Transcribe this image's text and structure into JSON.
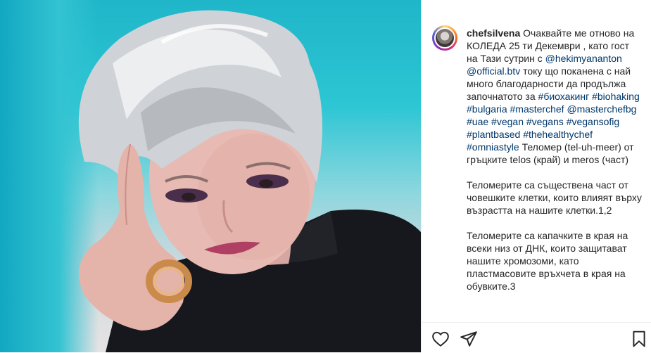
{
  "post": {
    "media_alt": "",
    "author": {
      "username": "chefsilvena",
      "avatar_icon": "avatar"
    },
    "caption": {
      "p1_text1": " Очаквайте ме отново на КОЛЕДА 25 ти Декември , като гост на Тази сутрин с ",
      "p1_mention1": "@hekimyananton",
      "p1_text2": " ",
      "p1_mention2": "@official.btv",
      "p1_text3": " току що поканена с най много благодарности да продължа започнатото за ",
      "p1_tag1": "#биохакинг",
      "p1_tag2": "#biohaking",
      "p1_tag3": "#bulgaria",
      "p1_tag4": "#masterchef",
      "p1_mention3": "@masterchefbg",
      "p1_tag5": "#uae",
      "p1_tag6": "#vegan",
      "p1_tag7": "#vegans",
      "p1_tag8": "#vegansofig",
      "p1_tag9": "#plantbased",
      "p1_tag10": "#thehealthychef",
      "p1_tag11": "#omniastyle",
      "p1_text4": " Теломер (tel-uh-meer) от гръцките telos (край) и meros (част)",
      "p2": "Теломерите са съществена част от човешките клетки, които влияят върху възрастта на нашите клетки.1,2",
      "p3": "Теломерите са капачките в края на всеки низ от ДНК, които защитават нашите хромозоми, като пластмасовите връхчета в края на обувките.3"
    },
    "actions": {
      "like_icon": "heart-icon",
      "share_icon": "paper-plane-icon",
      "save_icon": "bookmark-icon"
    },
    "colors": {
      "link": "#00376b",
      "text": "#262626",
      "border": "#efefef"
    }
  }
}
